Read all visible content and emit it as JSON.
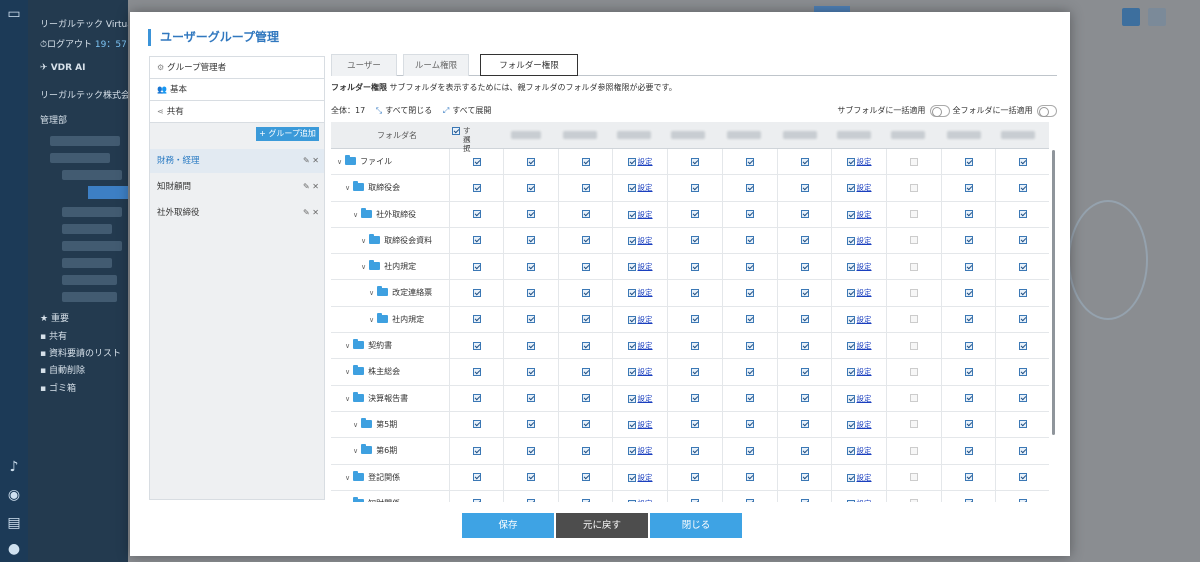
{
  "app": {
    "title": "リーガルテック Virtual D",
    "logout_label": "ログアウト",
    "logout_timer": "19：57",
    "vdr_ai": "VDR AI",
    "company": "リーガルテック株式会社",
    "department": "管理部",
    "nav_items": [
      "重要",
      "共有",
      "資料要請のリスト",
      "自動削除",
      "ゴミ箱"
    ]
  },
  "modal": {
    "title": "ユーザーグループ管理",
    "left_panel": {
      "rows": [
        {
          "icon": "gear-icon",
          "label": "グループ管理者"
        },
        {
          "icon": "users-icon",
          "label": "基本"
        },
        {
          "icon": "share-icon",
          "label": "共有"
        }
      ],
      "add_button": "+ グループ追加",
      "groups": [
        {
          "label": "財務・経理",
          "selected": true
        },
        {
          "label": "知財顧問",
          "selected": false
        },
        {
          "label": "社外取締役",
          "selected": false
        }
      ]
    },
    "tabs": [
      "ユーザー",
      "ルーム権限",
      "フォルダー権限"
    ],
    "active_tab": "フォルダー権限",
    "permission": {
      "title": "フォルダー権限",
      "description": "サブフォルダを表示するためには、親フォルダのフォルダ参照権限が必要です。"
    },
    "toolbar": {
      "total_label": "全体：",
      "total_count": "17",
      "collapse_all": "すべて閉じる",
      "expand_all": "すべて展開",
      "subfolder_bulk": "サブフォルダに一括適用",
      "allfolder_bulk": "全フォルダに一括適用"
    },
    "table": {
      "header_folder": "フォルダ名",
      "header_select_all": [
        "すべて",
        "選択"
      ],
      "setting_label": "設定",
      "rows": [
        {
          "name": "ファイル",
          "depth": 0
        },
        {
          "name": "取締役会",
          "depth": 1
        },
        {
          "name": "社外取締役",
          "depth": 2
        },
        {
          "name": "取締役会資料",
          "depth": 3
        },
        {
          "name": "社内規定",
          "depth": 3
        },
        {
          "name": "改定連絡票",
          "depth": 4
        },
        {
          "name": "社内規定",
          "depth": 4
        },
        {
          "name": "契約書",
          "depth": 1
        },
        {
          "name": "株主総会",
          "depth": 1
        },
        {
          "name": "決算報告書",
          "depth": 1
        },
        {
          "name": "第5期",
          "depth": 2
        },
        {
          "name": "第6期",
          "depth": 2
        },
        {
          "name": "登記関係",
          "depth": 1
        },
        {
          "name": "知財関係",
          "depth": 1
        }
      ]
    },
    "buttons": {
      "save": "保存",
      "revert": "元に戻す",
      "close": "閉じる"
    }
  }
}
